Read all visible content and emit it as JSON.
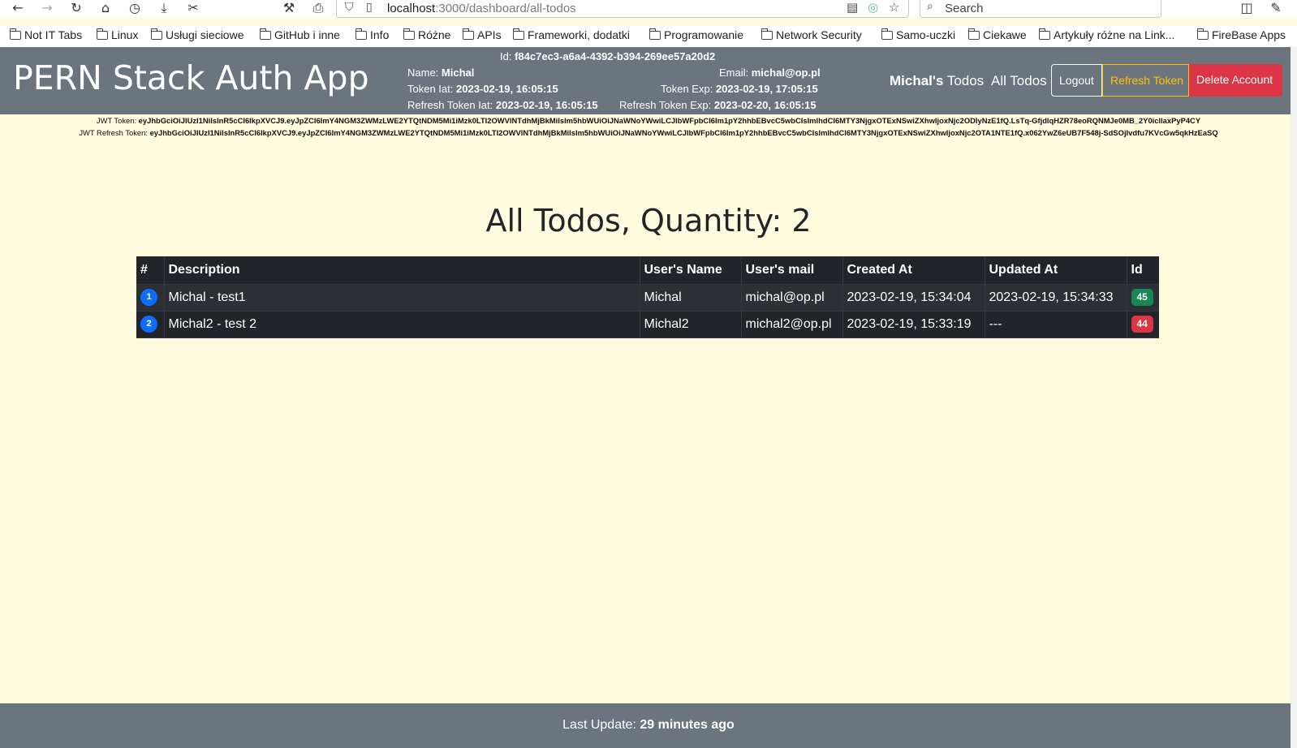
{
  "browser": {
    "url_host": "localhost",
    "url_path": ":3000/dashboard/all-todos",
    "search_placeholder": "Search",
    "nav_icons": [
      "back-icon",
      "forward-icon",
      "reload-icon",
      "home-icon",
      "history-icon",
      "download-icon",
      "screenshot-icon",
      "wrench-icon",
      "print-icon"
    ]
  },
  "bookmarks": [
    "Not IT Tabs",
    "Linux",
    "Usługi sieciowe",
    "GitHub i inne",
    "Info",
    "Różne",
    "APIs",
    "Frameworki, dodatki",
    "Programowanie",
    "Network Security",
    "Samo-uczki",
    "Ciekawe",
    "Artykuły różne na Link...",
    "FireBase Apps"
  ],
  "navbar": {
    "brand": "PERN Stack Auth App",
    "id_label": "Id:",
    "id_value": "f84c7ec3-a6a4-4392-b394-269ee57a20d2",
    "name_label": "Name:",
    "name_value": "Michal",
    "email_label": "Email:",
    "email_value": "michal@op.pl",
    "token_iat_label": "Token Iat:",
    "token_iat_value": "2023-02-19, 16:05:15",
    "token_exp_label": "Token Exp:",
    "token_exp_value": "2023-02-19, 17:05:15",
    "refresh_iat_label": "Refresh Token Iat:",
    "refresh_iat_value": "2023-02-19, 16:05:15",
    "refresh_exp_label": "Refresh Token Exp:",
    "refresh_exp_value": "2023-02-20, 16:05:15",
    "my_todos_name": "Michal's",
    "my_todos_suffix": " Todos",
    "all_todos": "All Todos",
    "logout": "Logout",
    "refresh_token": "Refresh Token",
    "delete_account": "Delete Account"
  },
  "jwt": {
    "token_label": "JWT Token:",
    "token_value": "eyJhbGciOiJIUzI1NiIsInR5cCI6IkpXVCJ9.eyJpZCI6ImY4NGM3ZWMzLWE2YTQtNDM5Mi1iMzk0LTI2OWVlNTdhMjBkMiIsIm5hbWUiOiJNaWNoYWwiLCJlbWFpbCI6Im1pY2hhbEBvcC5wbCIsImlhdCI6MTY3NjgxOTExNSwiZXhwIjoxNjc2ODIyNzE1fQ.LsTq-GfjdlqHZR78eoRQNMJe0MB_2Y0icllaxPyP4CY",
    "refresh_label": "JWT Refresh Token:",
    "refresh_value": "eyJhbGciOiJIUzI1NiIsInR5cCI6IkpXVCJ9.eyJpZCI6ImY4NGM3ZWMzLWE2YTQtNDM5Mi1iMzk0LTI2OWVlNTdhMjBkMiIsIm5hbWUiOiJNaWNoYWwiLCJlbWFpbCI6Im1pY2hhbEBvcC5wbCIsImlhdCI6MTY3NjgxOTExNSwiZXhwIjoxNjc2OTA1NTE1fQ.x062YwZ6eUB7F548j-SdSOjIvdfu7KVcGw5qkHzEaSQ"
  },
  "heading": "All Todos, Quantity: 2",
  "table": {
    "headers": [
      "#",
      "Description",
      "User's Name",
      "User's mail",
      "Created At",
      "Updated At",
      "Id"
    ],
    "rows": [
      {
        "num": "1",
        "description": "Michal - test1",
        "user_name": "Michal",
        "user_mail": "michal@op.pl",
        "created_at": "2023-02-19, 15:34:04",
        "updated_at": "2023-02-19, 15:34:33",
        "id": "45",
        "id_color": "#198754"
      },
      {
        "num": "2",
        "description": "Michal2 - test 2",
        "user_name": "Michal2",
        "user_mail": "michal2@op.pl",
        "created_at": "2023-02-19, 15:33:19",
        "updated_at": "---",
        "id": "44",
        "id_color": "#dc3545"
      }
    ]
  },
  "footer": {
    "label": "Last Update:",
    "value": "29 minutes ago"
  },
  "colors": {
    "page_bg": "#fffbdf",
    "navbar_bg": "#6c757d",
    "table_bg": "#212529",
    "badge_blue": "#0d6efd",
    "warning": "#ffc107",
    "danger": "#dc3545"
  }
}
